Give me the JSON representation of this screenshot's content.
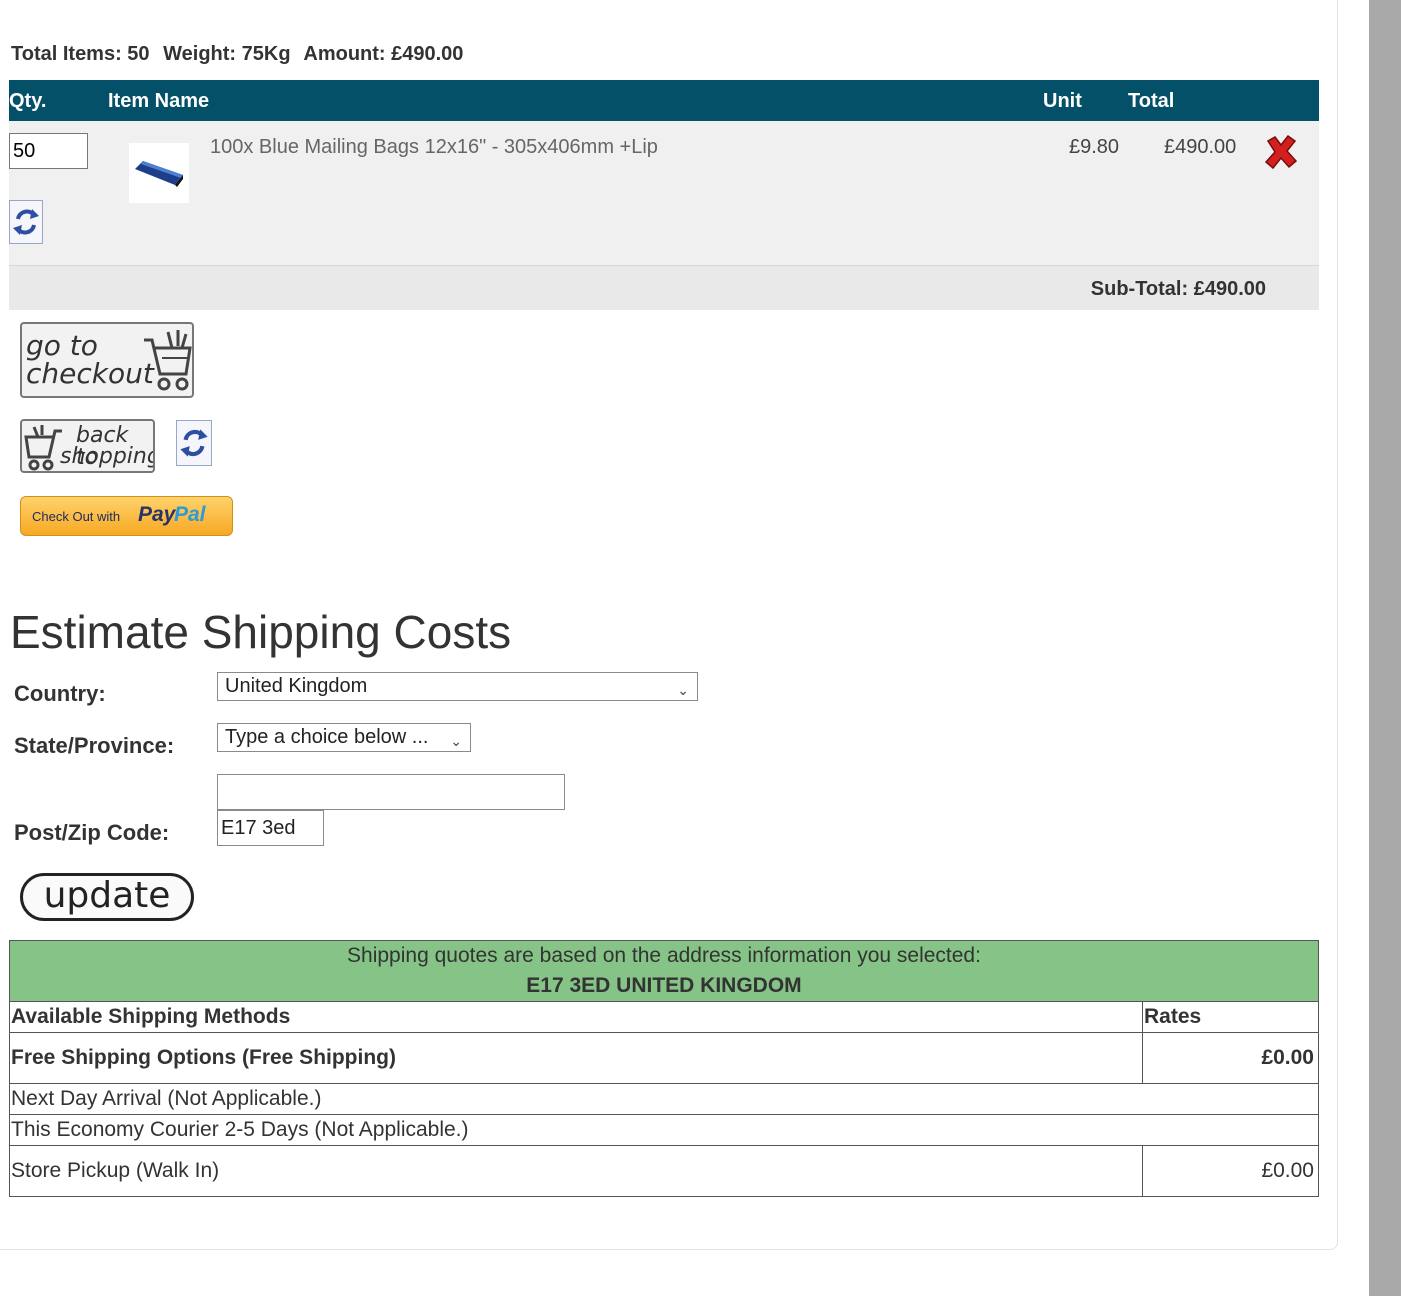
{
  "summary": {
    "total_items": "Total Items: 50",
    "weight": "Weight: 75Kg",
    "amount": "Amount: £490.00"
  },
  "cart": {
    "headers": {
      "qty": "Qty.",
      "item_name": "Item Name",
      "unit": "Unit",
      "total": "Total"
    },
    "items": [
      {
        "qty": "50",
        "name": "100x Blue Mailing Bags 12x16\" - 305x406mm +Lip",
        "unit": "£9.80",
        "total": "£490.00"
      }
    ],
    "subtotal": "Sub-Total: £490.00"
  },
  "buttons": {
    "checkout_line1": "go to",
    "checkout_line2": "checkout",
    "back_line1": "back to",
    "back_line2": "shopping",
    "paypal_prefix": "Check Out with",
    "paypal_pay": "Pay",
    "paypal_pal": "Pal",
    "update": "update"
  },
  "shipping": {
    "heading": "Estimate Shipping Costs",
    "country_label": "Country:",
    "country_value": "United Kingdom",
    "state_label": "State/Province:",
    "state_value": "Type a choice below ...",
    "state_text_value": "",
    "postcode_label": "Post/Zip Code:",
    "postcode_value": "E17 3ed",
    "quote_note": "Shipping quotes are based on the address information you selected:",
    "quote_address": "E17 3ED UNITED KINGDOM",
    "col_methods": "Available Shipping Methods",
    "col_rates": "Rates",
    "methods": [
      {
        "name": "Free Shipping Options (Free Shipping)",
        "rate": "£0.00",
        "bold": true
      },
      {
        "name": "Next Day Arrival (Not Applicable.)",
        "rate": ""
      },
      {
        "name": "This Economy Courier 2-5 Days (Not Applicable.)",
        "rate": ""
      },
      {
        "name": "Store Pickup (Walk In)",
        "rate": "£0.00"
      }
    ]
  },
  "icons": {
    "refresh": "refresh-icon",
    "remove": "remove-x-icon",
    "cart": "shopping-cart-icon",
    "chevron": "chevron-down-icon"
  },
  "colors": {
    "header_bg": "#045068",
    "row_bg": "#f0f0f0",
    "quote_bg": "#85c386",
    "paypal_gold": "#f7a823"
  }
}
